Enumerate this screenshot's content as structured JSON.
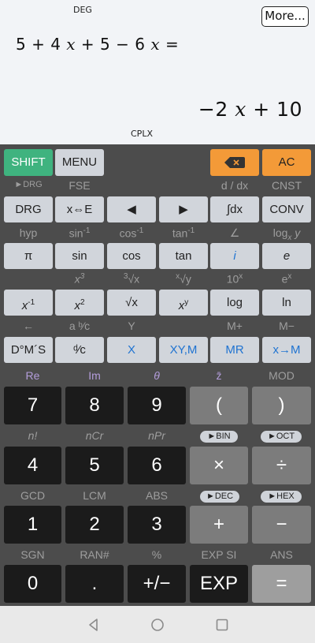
{
  "display": {
    "angle_mode": "DEG",
    "complex_mode": "CPLX",
    "more_label": "More...",
    "expression": {
      "a": "5 + 4 ",
      "v1": "x",
      "b": " + 5 − 6 ",
      "v2": "x",
      "c": " ="
    },
    "result": {
      "a": "−2 ",
      "v": "x",
      "b": " + 10"
    }
  },
  "keys": {
    "shift": "SHIFT",
    "menu": "MENU",
    "ac": "AC",
    "drg": "DRG",
    "xe": "x⇔E",
    "left": "◀",
    "right": "▶",
    "integral": "∫dx",
    "conv": "CONV",
    "pi": "π",
    "sin": "sin",
    "cos": "cos",
    "tan": "tan",
    "i": "i",
    "e": "e",
    "inv": "x",
    "inv_sup": "-1",
    "sq": "x",
    "sq_sup": "2",
    "sqrt": "√x",
    "pow": "x",
    "pow_sup": "y",
    "log": "log",
    "ln": "ln",
    "dms": "D°M´S",
    "frac": "ᵈ⁄c",
    "X": "X",
    "xym": "XY,M",
    "mr": "MR",
    "xtom": "x→M",
    "n7": "7",
    "n8": "8",
    "n9": "9",
    "lparen": "(",
    "rparen": ")",
    "n4": "4",
    "n5": "5",
    "n6": "6",
    "mul": "×",
    "div": "÷",
    "n1": "1",
    "n2": "2",
    "n3": "3",
    "add": "+",
    "sub": "−",
    "n0": "0",
    "dot": ".",
    "neg": "+/−",
    "exp": "EXP",
    "eq": "="
  },
  "shift_labels": {
    "r1": {
      "drg": "►DRG",
      "fse": "FSE",
      "ddx": "d / dx",
      "cnst": "CNST"
    },
    "r2": {
      "hyp": "hyp",
      "asin": "sin",
      "acos": "cos",
      "atan": "tan",
      "inv_sup": "-1",
      "angle": "∠",
      "logxy": "log",
      "logxy_sub": "x",
      "logxy_y": "y"
    },
    "r3": {
      "cube": "x",
      "cube_sup": "3",
      "cbrt": "√x",
      "cbrt_idx": "3",
      "xroot": "√y",
      "xroot_idx": "x",
      "ten": "10",
      "ten_sup": "x",
      "ex": "e",
      "ex_sup": "x"
    },
    "r4": {
      "larrow": "←",
      "abc": "a ᵇ⁄c",
      "y": "Y",
      "mplus": "M+",
      "mminus": "M−"
    },
    "r5": {
      "re": "Re",
      "im": "Im",
      "theta": "θ",
      "zbar": "z̄",
      "mod": "MOD"
    },
    "r6": {
      "nfact": "n!",
      "ncr": "nCr",
      "npr": "nPr",
      "bin": "►BIN",
      "oct": "►OCT"
    },
    "r7": {
      "gcd": "GCD",
      "lcm": "LCM",
      "abs": "ABS",
      "dec": "►DEC",
      "hex": "►HEX"
    },
    "r8": {
      "sgn": "SGN",
      "ran": "RAN#",
      "pct": "%",
      "expsi": "EXP SI",
      "ans": "ANS"
    }
  },
  "colors": {
    "shift": "#3fb37f",
    "orange": "#f39a38",
    "blue_text": "#1f73d1"
  }
}
